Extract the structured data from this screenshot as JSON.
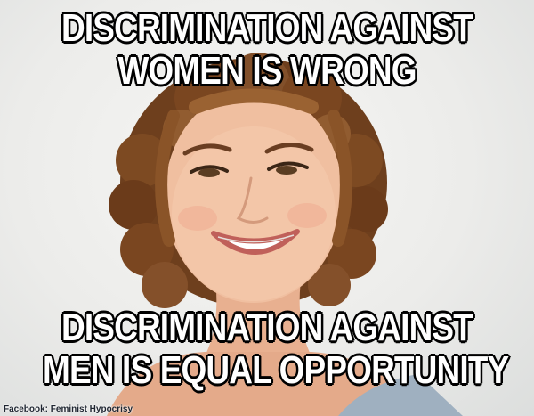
{
  "meme": {
    "top_lines": [
      "DISCRIMINATION AGAINST",
      "WOMEN IS WRONG"
    ],
    "bottom_lines": [
      "DISCRIMINATION AGAINST",
      "MEN IS EQUAL OPPORTUNITY"
    ],
    "source_credit": "Facebook: Feminist Hypocrisy"
  },
  "colors": {
    "background": "#ececea",
    "caption_text": "#ffffff",
    "caption_outline": "#000000",
    "hair": "#7a4a24",
    "skin": "#f0bfa0"
  }
}
